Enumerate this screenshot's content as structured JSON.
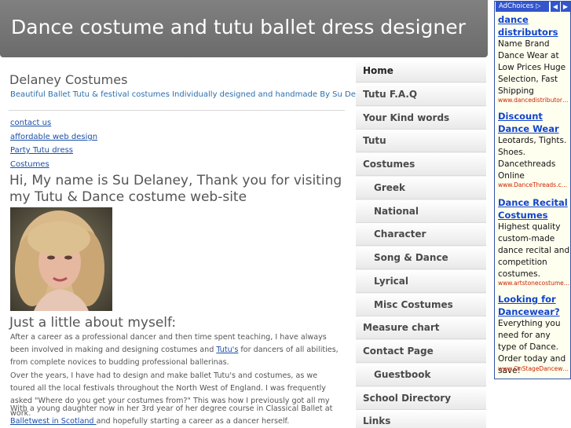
{
  "header": {
    "title": "Dance costume and tutu ballet dress designer"
  },
  "site": {
    "name": "Delaney Costumes",
    "tagline": "Beautiful Ballet Tutu & festival costumes Individually designed and handmade By Su Delaney ..."
  },
  "links": [
    "contact us",
    "affordable web design",
    "Party Tutu dress",
    "Costumes"
  ],
  "content": {
    "welcome": "Hi, My name is Su Delaney, Thank you for visiting my Tutu & Dance costume web-site",
    "about_heading": "Just a little about myself:",
    "p1_before": "After a career as a professional dancer and then time spent teaching, I have always been involved in making and designing costumes and ",
    "p1_link": "Tutu's",
    "p1_after": " for dancers of all abilities, from complete novices to budding professional ballerinas.",
    "p2": "Over the years, I have had to design and make ballet Tutu's and costumes, as we toured all the local festivals throughout the North West of England. I was frequently asked \"Where do you get your costumes from?\" This was how I previously got all my work.",
    "p3_before": "With a young daughter now in her 3rd year of her degree course in Classical Ballet at ",
    "p3_link": "Balletwest in Scotland ",
    "p3_after": " and hopefully starting a career as a dancer herself."
  },
  "nav": {
    "items": [
      {
        "label": "Home",
        "level": "top",
        "active": true
      },
      {
        "label": "Tutu F.A.Q",
        "level": "top"
      },
      {
        "label": "Your Kind words",
        "level": "top"
      },
      {
        "label": "Tutu",
        "level": "top"
      },
      {
        "label": "Costumes",
        "level": "top"
      },
      {
        "label": "Greek",
        "level": "sub"
      },
      {
        "label": "National",
        "level": "sub"
      },
      {
        "label": "Character",
        "level": "sub"
      },
      {
        "label": "Song & Dance",
        "level": "sub"
      },
      {
        "label": "Lyrical",
        "level": "sub"
      },
      {
        "label": "Misc Costumes",
        "level": "sub"
      },
      {
        "label": "Measure chart",
        "level": "top"
      },
      {
        "label": "Contact Page",
        "level": "top"
      },
      {
        "label": "Guestbook",
        "level": "sub"
      },
      {
        "label": "School Directory",
        "level": "top"
      },
      {
        "label": "Links",
        "level": "top"
      }
    ]
  },
  "ads": {
    "adchoices_label": "AdChoices",
    "items": [
      {
        "title": "dance distributors",
        "body": "Name Brand Dance Wear at Low Prices Huge Selection, Fast Shipping",
        "url": "www.dancedistributors.com"
      },
      {
        "title": "Discount Dance Wear",
        "body": "Leotards, Tights. Shoes. Dancethreads Online",
        "url": "www.DanceThreads.com"
      },
      {
        "title": "Dance Recital Costumes",
        "body": "Highest quality custom-made dance recital and competition costumes.",
        "url": "www.artstonecostumes.com"
      },
      {
        "title": "Looking for Dancewear?",
        "body": "Everything you need for any type of Dance. Order today and save!",
        "url": "www.OnStageDancewear.com"
      }
    ]
  },
  "colors": {
    "header_bg": "#7a7a7a",
    "link": "#1a4fa8",
    "tagline": "#2a6fb0",
    "ad_title": "#1144cc",
    "ad_url": "#cc2200"
  }
}
